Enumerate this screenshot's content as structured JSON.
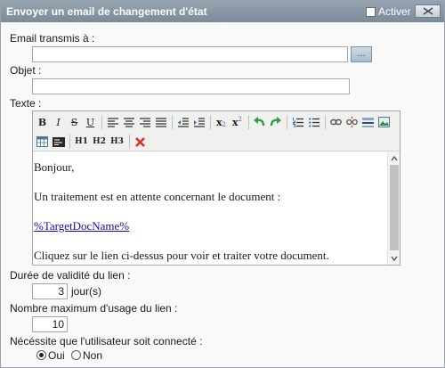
{
  "dialog": {
    "title": "Envoyer un email de changement d'état",
    "activer_label": "Activer",
    "activer_checked": false
  },
  "form": {
    "email_label": "Email transmis à :",
    "email_value": "",
    "browse_label": "...",
    "objet_label": "Objet :",
    "objet_value": "",
    "texte_label": "Texte :"
  },
  "toolbar": {
    "row1": [
      "bold-icon",
      "italic-icon",
      "strikethrough-icon",
      "underline-icon",
      "align-left-icon",
      "align-center-icon",
      "align-right-icon",
      "align-justify-icon",
      "outdent-icon",
      "indent-icon",
      "subscript-icon",
      "superscript-icon",
      "undo-icon",
      "redo-icon",
      "numbered-list-icon",
      "bullet-list-icon",
      "link-icon",
      "unlink-icon",
      "horizontal-rule-icon",
      "image-icon"
    ],
    "row2": [
      "table-icon",
      "source-code-icon",
      "heading-1",
      "heading-2",
      "heading-3",
      "remove-format-icon"
    ],
    "bold": "B",
    "italic": "I",
    "strike": "S",
    "underline": "U",
    "sub": "x",
    "sub_mark": "2",
    "sup": "x",
    "sup_mark": "2",
    "h1": "H1",
    "h2": "H2",
    "h3": "H3"
  },
  "editor": {
    "lines": [
      "Bonjour,",
      "Un traitement est en attente concernant le document :",
      "%TargetDocName%",
      "Cliquez sur le lien ci-dessus pour voir et traiter votre document."
    ]
  },
  "validity": {
    "label": "Durée de validité du lien :",
    "value": "3",
    "unit": "jour(s)"
  },
  "usage": {
    "label": "Nombre maximum d'usage du lien :",
    "value": "10"
  },
  "connected": {
    "label": "Nécéssite que l'utilisateur soit connecté :",
    "options": [
      "Oui",
      "Non"
    ],
    "selected": "Oui"
  },
  "colors": {
    "titlebar": "#8896a5",
    "link": "#1a0dab",
    "delete": "#d9302b",
    "undo": "#2f9e3f"
  }
}
